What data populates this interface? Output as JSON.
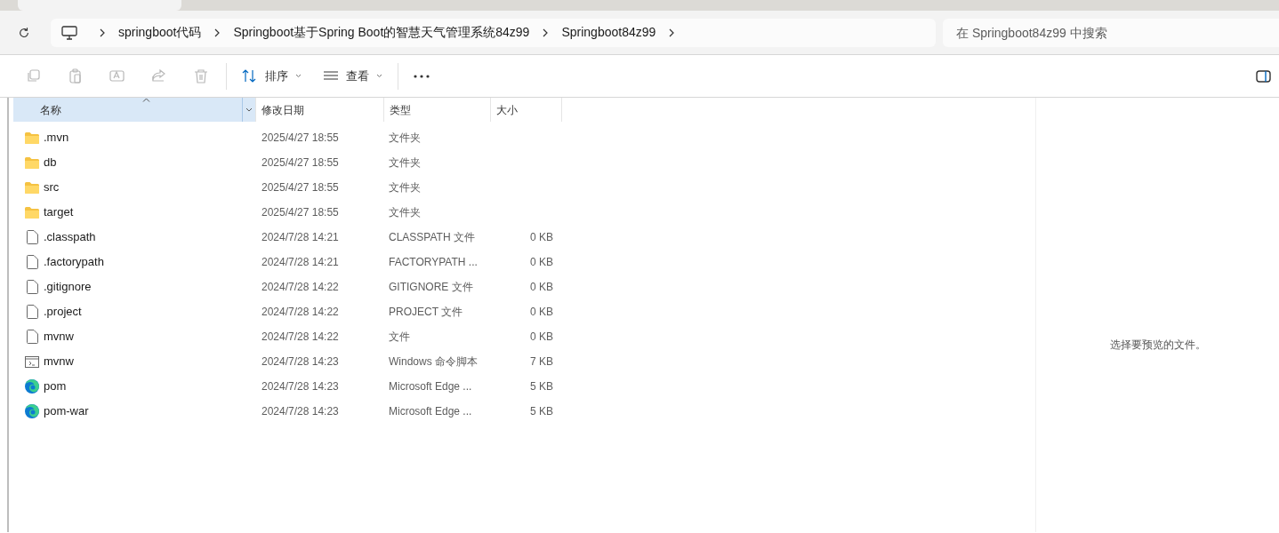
{
  "breadcrumb": [
    "springboot代码",
    "Springboot基于Spring Boot的智慧天气管理系统84z99",
    "Springboot84z99"
  ],
  "search": {
    "placeholder": "在 Springboot84z99 中搜索"
  },
  "toolbar": [
    {
      "kind": "copy",
      "disabled": true
    },
    {
      "kind": "paste",
      "disabled": true
    },
    {
      "kind": "rename",
      "disabled": true
    },
    {
      "kind": "share",
      "disabled": true
    },
    {
      "kind": "delete",
      "disabled": true
    },
    {
      "kind": "sort",
      "label": "排序",
      "disabled": false
    },
    {
      "kind": "view",
      "label": "查看",
      "disabled": false
    },
    {
      "kind": "more",
      "disabled": false
    }
  ],
  "columns": [
    {
      "label": "名称",
      "selected": true
    },
    {
      "label": "修改日期",
      "selected": false
    },
    {
      "label": "类型",
      "selected": false
    },
    {
      "label": "大小",
      "selected": false
    }
  ],
  "rows": [
    {
      "kind": "folder",
      "name": ".mvn",
      "date": "2025/4/27 18:55",
      "type": "文件夹"
    },
    {
      "kind": "folder",
      "name": "db",
      "date": "2025/4/27 18:55",
      "type": "文件夹"
    },
    {
      "kind": "folder",
      "name": "src",
      "date": "2025/4/27 18:55",
      "type": "文件夹"
    },
    {
      "kind": "folder",
      "name": "target",
      "date": "2025/4/27 18:55",
      "type": "文件夹"
    },
    {
      "kind": "file",
      "name": ".classpath",
      "date": "2024/7/28 14:21",
      "type": "CLASSPATH 文件",
      "size": "0 KB"
    },
    {
      "kind": "file",
      "name": ".factorypath",
      "date": "2024/7/28 14:21",
      "type": "FACTORYPATH ...",
      "size": "0 KB"
    },
    {
      "kind": "file",
      "name": ".gitignore",
      "date": "2024/7/28 14:22",
      "type": "GITIGNORE 文件",
      "size": "0 KB"
    },
    {
      "kind": "file",
      "name": ".project",
      "date": "2024/7/28 14:22",
      "type": "PROJECT 文件",
      "size": "0 KB"
    },
    {
      "kind": "file",
      "name": "mvnw",
      "date": "2024/7/28 14:22",
      "type": "文件",
      "size": "0 KB"
    },
    {
      "kind": "script",
      "name": "mvnw",
      "date": "2024/7/28 14:23",
      "type": "Windows 命令脚本",
      "size": "7 KB"
    },
    {
      "kind": "edge",
      "name": "pom",
      "date": "2024/7/28 14:23",
      "type": "Microsoft Edge ...",
      "size": "5 KB"
    },
    {
      "kind": "edge",
      "name": "pom-war",
      "date": "2024/7/28 14:23",
      "type": "Microsoft Edge ...",
      "size": "5 KB"
    }
  ],
  "preview": {
    "message": "选择要预览的文件。"
  }
}
